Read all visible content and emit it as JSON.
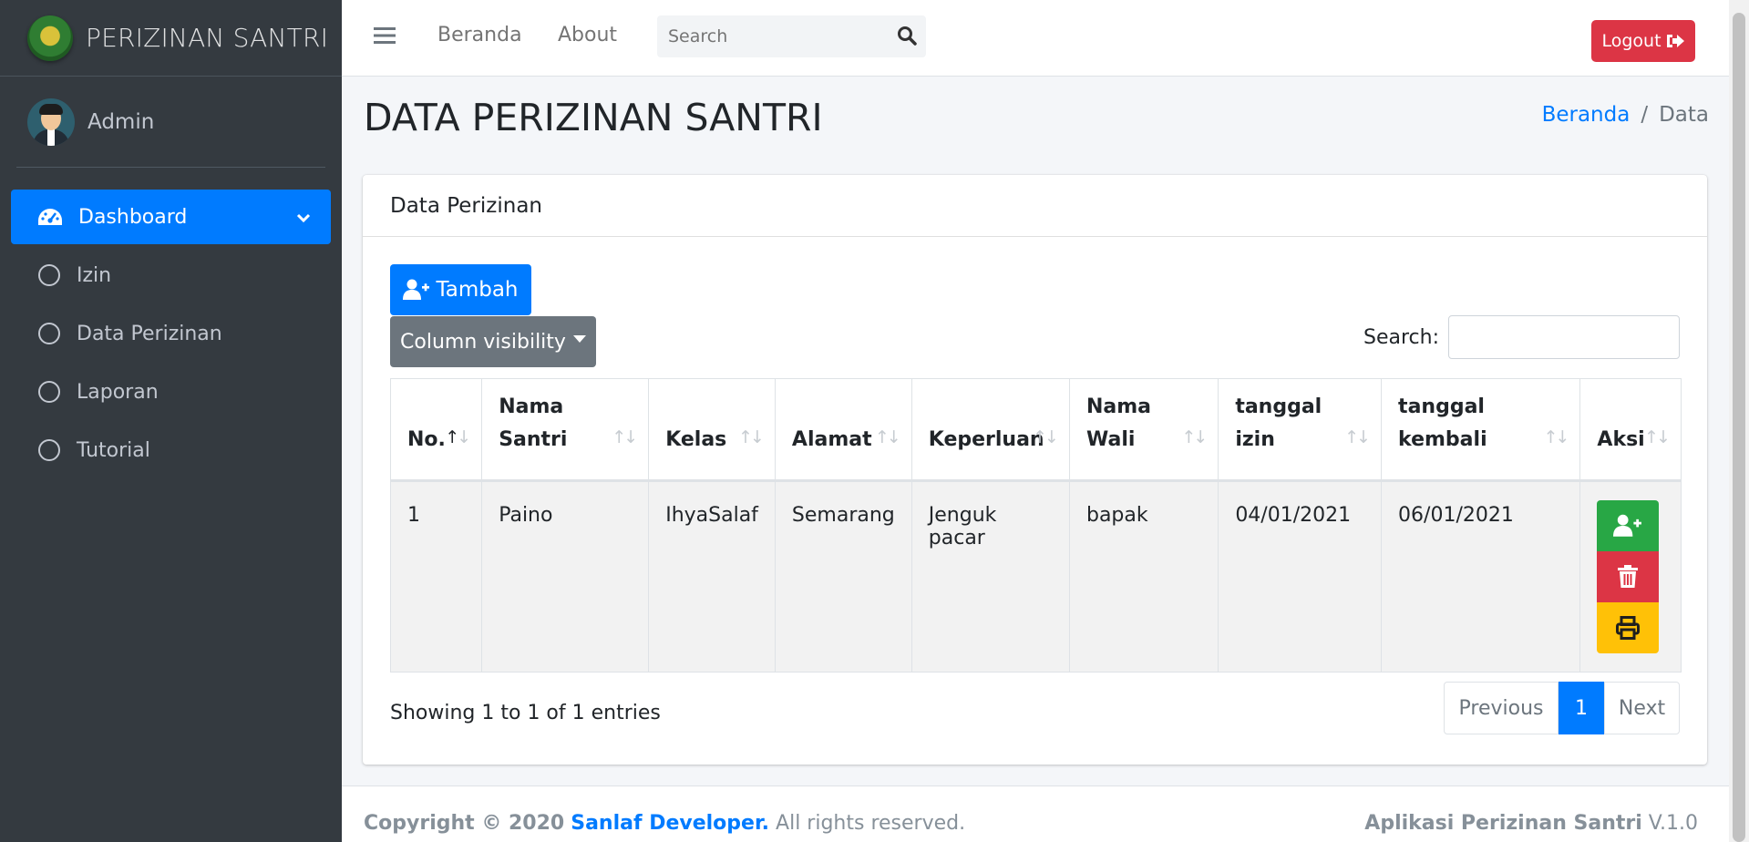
{
  "brand": {
    "title": "PERIZINAN SANTRI"
  },
  "user": {
    "name": "Admin"
  },
  "sidebar": {
    "items": [
      {
        "label": "Dashboard",
        "active": true,
        "icon": "tachometer-icon"
      },
      {
        "label": "Izin",
        "icon": "circle-icon"
      },
      {
        "label": "Data Perizinan",
        "icon": "circle-icon"
      },
      {
        "label": "Laporan",
        "icon": "circle-icon"
      },
      {
        "label": "Tutorial",
        "icon": "circle-icon"
      }
    ]
  },
  "topbar": {
    "links": [
      "Beranda",
      "About"
    ],
    "search_placeholder": "Search",
    "logout_label": "Logout"
  },
  "page": {
    "title": "DATA PERIZINAN SANTRI",
    "breadcrumb": {
      "home": "Beranda",
      "sep": "/",
      "current": "Data"
    }
  },
  "card": {
    "header": "Data Perizinan",
    "add_button": "Tambah",
    "colvis_button": "Column visibility",
    "search_label": "Search:"
  },
  "table": {
    "columns": [
      [
        "No."
      ],
      [
        "Nama",
        "Santri"
      ],
      [
        "Kelas"
      ],
      [
        "Alamat"
      ],
      [
        "Keperluan"
      ],
      [
        "Nama",
        "Wali"
      ],
      [
        "tanggal",
        "izin"
      ],
      [
        "tanggal",
        "kembali"
      ],
      [
        "Aksi"
      ]
    ],
    "rows": [
      [
        "1",
        "Paino",
        "IhyaSalaf",
        "Semarang",
        "Jenguk pacar",
        "bapak",
        "04/01/2021",
        "06/01/2021"
      ]
    ],
    "info": "Showing 1 to 1 of 1 entries",
    "pager": {
      "prev": "Previous",
      "current": "1",
      "next": "Next"
    }
  },
  "footer": {
    "copyright": "Copyright © 2020",
    "developer": "Sanlaf Developer.",
    "rights": "All rights reserved.",
    "app_name": "Aplikasi Perizinan Santri",
    "version": "V.1.0"
  },
  "colors": {
    "primary": "#007bff",
    "danger": "#dc3545",
    "success": "#28a745",
    "warning": "#ffc107",
    "sidebar": "#343a40"
  }
}
